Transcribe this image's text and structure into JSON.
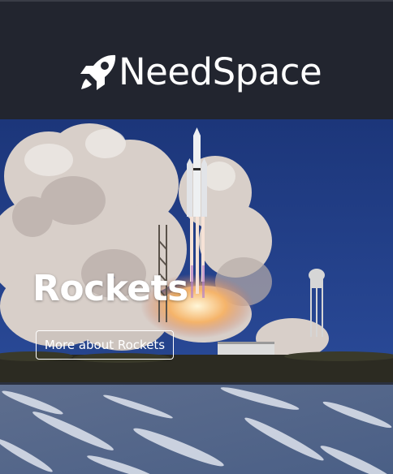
{
  "brand": {
    "name": "NeedSpace",
    "icon": "rocket-icon"
  },
  "hero": {
    "title": "Rockets",
    "button_label": "More about Rockets",
    "image": "rocket-launch-photo"
  },
  "next_section": {
    "image": "earth-clouds-photo"
  },
  "colors": {
    "header_bg": "#22252f",
    "text": "#ffffff",
    "sky": "#1f3b7c"
  }
}
